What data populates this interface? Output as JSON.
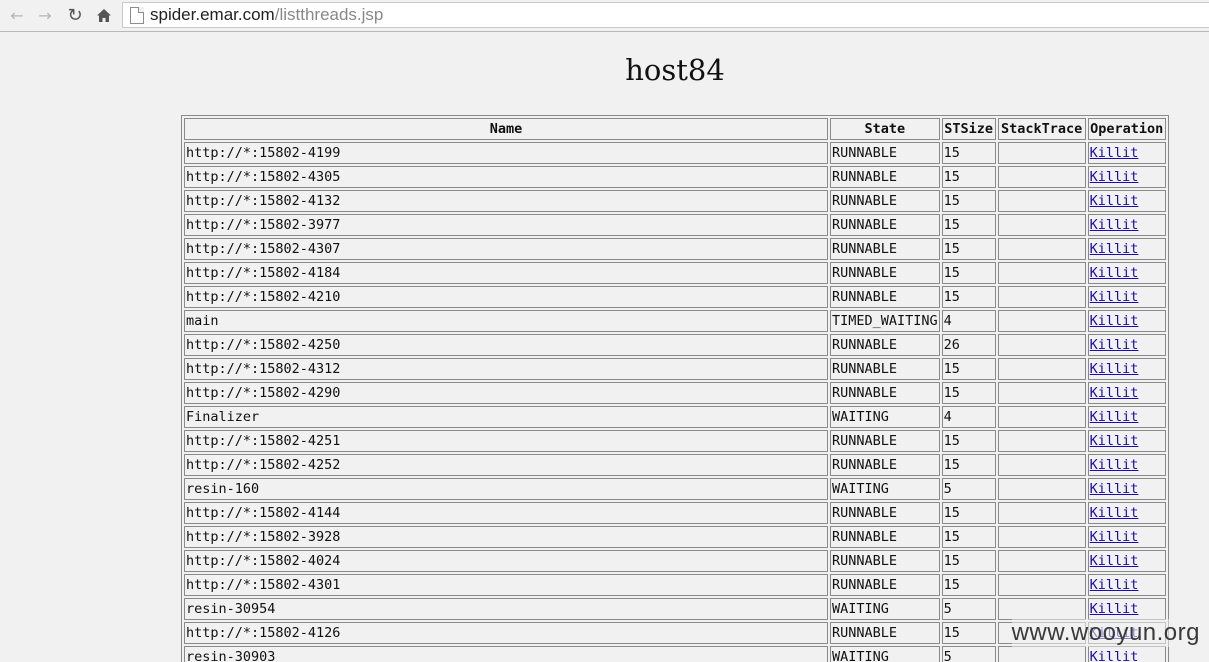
{
  "browser": {
    "url_host": "spider.emar.com",
    "url_path": "/listthreads.jsp",
    "back_icon": "arrow-left-icon",
    "forward_icon": "arrow-right-icon",
    "reload_icon": "reload-icon",
    "home_icon": "home-icon"
  },
  "page": {
    "title": "host84",
    "headers": [
      "Name",
      "State",
      "STSize",
      "StackTrace",
      "Operation"
    ],
    "rows": [
      {
        "name": "http://*:15802-4199",
        "state": "RUNNABLE",
        "stsize": "15",
        "stacktrace": "",
        "op": "Killit"
      },
      {
        "name": "http://*:15802-4305",
        "state": "RUNNABLE",
        "stsize": "15",
        "stacktrace": "",
        "op": "Killit"
      },
      {
        "name": "http://*:15802-4132",
        "state": "RUNNABLE",
        "stsize": "15",
        "stacktrace": "",
        "op": "Killit"
      },
      {
        "name": "http://*:15802-3977",
        "state": "RUNNABLE",
        "stsize": "15",
        "stacktrace": "",
        "op": "Killit"
      },
      {
        "name": "http://*:15802-4307",
        "state": "RUNNABLE",
        "stsize": "15",
        "stacktrace": "",
        "op": "Killit"
      },
      {
        "name": "http://*:15802-4184",
        "state": "RUNNABLE",
        "stsize": "15",
        "stacktrace": "",
        "op": "Killit"
      },
      {
        "name": "http://*:15802-4210",
        "state": "RUNNABLE",
        "stsize": "15",
        "stacktrace": "",
        "op": "Killit"
      },
      {
        "name": "main",
        "state": "TIMED_WAITING",
        "stsize": "4",
        "stacktrace": "",
        "op": "Killit"
      },
      {
        "name": "http://*:15802-4250",
        "state": "RUNNABLE",
        "stsize": "26",
        "stacktrace": "",
        "op": "Killit"
      },
      {
        "name": "http://*:15802-4312",
        "state": "RUNNABLE",
        "stsize": "15",
        "stacktrace": "",
        "op": "Killit"
      },
      {
        "name": "http://*:15802-4290",
        "state": "RUNNABLE",
        "stsize": "15",
        "stacktrace": "",
        "op": "Killit"
      },
      {
        "name": "Finalizer",
        "state": "WAITING",
        "stsize": "4",
        "stacktrace": "",
        "op": "Killit"
      },
      {
        "name": "http://*:15802-4251",
        "state": "RUNNABLE",
        "stsize": "15",
        "stacktrace": "",
        "op": "Killit"
      },
      {
        "name": "http://*:15802-4252",
        "state": "RUNNABLE",
        "stsize": "15",
        "stacktrace": "",
        "op": "Killit"
      },
      {
        "name": "resin-160",
        "state": "WAITING",
        "stsize": "5",
        "stacktrace": "",
        "op": "Killit"
      },
      {
        "name": "http://*:15802-4144",
        "state": "RUNNABLE",
        "stsize": "15",
        "stacktrace": "",
        "op": "Killit"
      },
      {
        "name": "http://*:15802-3928",
        "state": "RUNNABLE",
        "stsize": "15",
        "stacktrace": "",
        "op": "Killit"
      },
      {
        "name": "http://*:15802-4024",
        "state": "RUNNABLE",
        "stsize": "15",
        "stacktrace": "",
        "op": "Killit"
      },
      {
        "name": "http://*:15802-4301",
        "state": "RUNNABLE",
        "stsize": "15",
        "stacktrace": "",
        "op": "Killit"
      },
      {
        "name": "resin-30954",
        "state": "WAITING",
        "stsize": "5",
        "stacktrace": "",
        "op": "Killit"
      },
      {
        "name": "http://*:15802-4126",
        "state": "RUNNABLE",
        "stsize": "15",
        "stacktrace": "",
        "op": "Killit"
      },
      {
        "name": "resin-30903",
        "state": "WAITING",
        "stsize": "5",
        "stacktrace": "",
        "op": "Killit"
      }
    ]
  },
  "watermark": "www.wooyun.org"
}
